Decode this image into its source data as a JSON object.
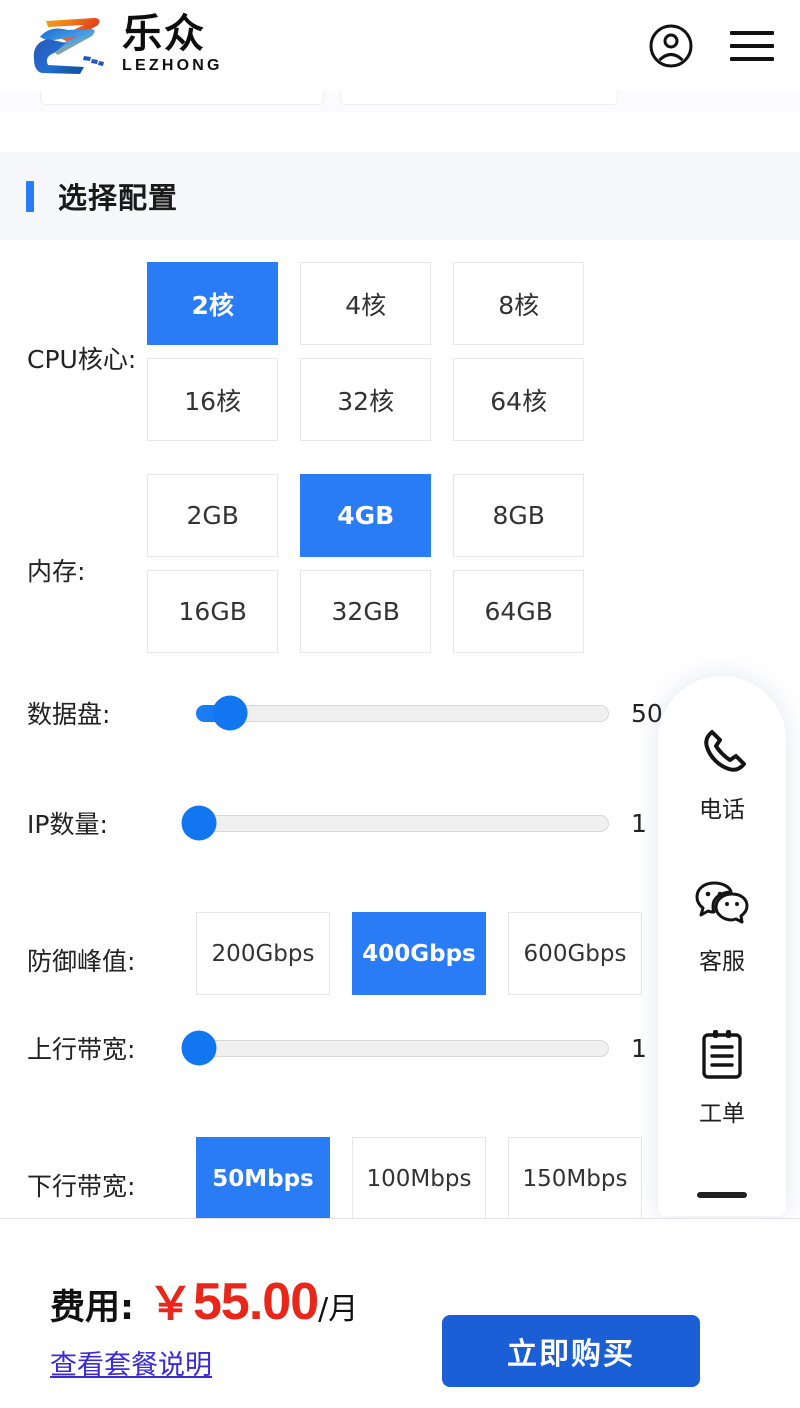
{
  "header": {
    "logo_cn": "乐众",
    "logo_en": "LEZHONG",
    "account_icon": "user-account-icon",
    "menu_icon": "hamburger-menu-icon"
  },
  "section": {
    "title": "选择配置"
  },
  "config": {
    "rows": [
      {
        "key": "cpu",
        "label": "CPU核心:",
        "type": "options",
        "options": [
          "2核",
          "4核",
          "8核",
          "16核",
          "32核",
          "64核"
        ],
        "selected": "2核"
      },
      {
        "key": "memory",
        "label": "内存:",
        "type": "options",
        "options": [
          "2GB",
          "4GB",
          "8GB",
          "16GB",
          "32GB",
          "64GB"
        ],
        "selected": "4GB"
      },
      {
        "key": "datadisk",
        "label": "数据盘:",
        "type": "slider",
        "value_text": "50",
        "percent": 6
      },
      {
        "key": "ipcount",
        "label": "IP数量:",
        "type": "slider",
        "value_text": "1",
        "percent": 0
      },
      {
        "key": "defense",
        "label": "防御峰值:",
        "type": "options",
        "options": [
          "200Gbps",
          "400Gbps",
          "600Gbps"
        ],
        "selected": "400Gbps"
      },
      {
        "key": "upbandwidth",
        "label": "上行带宽:",
        "type": "slider",
        "value_text": "1",
        "percent": 0
      },
      {
        "key": "downbandwidth",
        "label": "下行带宽:",
        "type": "options",
        "options": [
          "50Mbps",
          "100Mbps",
          "150Mbps"
        ],
        "selected": "50Mbps"
      }
    ]
  },
  "contact_panel": {
    "items": [
      {
        "icon": "phone-icon",
        "label": "电话"
      },
      {
        "icon": "wechat-icon",
        "label": "客服"
      },
      {
        "icon": "ticket-clipboard-icon",
        "label": "工单"
      }
    ],
    "collapse_handle": "collapse-handle"
  },
  "buy_bar": {
    "price_label": "费用:",
    "currency": "￥",
    "amount": "55.00",
    "unit": "/月",
    "package_link": "查看套餐说明",
    "buy_button": "立即购买"
  },
  "colors": {
    "accent_blue": "#2a7bf6",
    "price_red": "#e8261a",
    "buy_blue": "#1a5fd6",
    "link_purple": "#3a2bd6"
  }
}
